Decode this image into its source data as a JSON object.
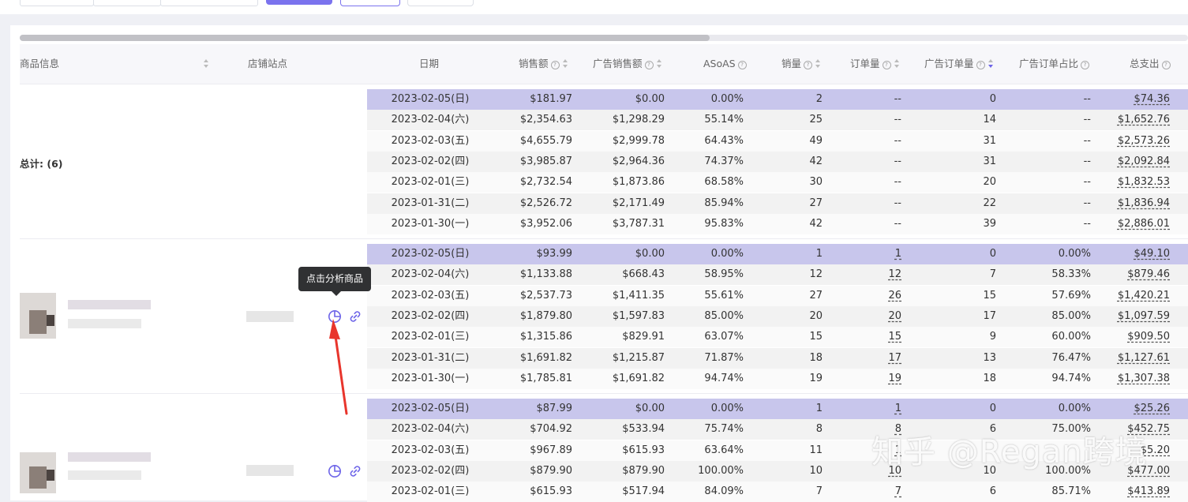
{
  "table": {
    "columns": {
      "product": "商品信息",
      "shop": "店铺站点",
      "date": "日期",
      "sales": "销售额",
      "ad_sales": "广告销售额",
      "asoas": "ASoAS",
      "units": "销量",
      "orders": "订单量",
      "ad_orders": "广告订单量",
      "ad_order_ratio": "广告订单占比",
      "total_spend": "总支出"
    },
    "total_label": "总计: (6)",
    "groups": [
      {
        "rows": [
          {
            "date": "2023-02-05(日)",
            "sales": "$181.97",
            "ad_sales": "$0.00",
            "asoas": "0.00%",
            "units": "2",
            "orders": "--",
            "ad_orders": "0",
            "ratio": "--",
            "spend": "$74.36"
          },
          {
            "date": "2023-02-04(六)",
            "sales": "$2,354.63",
            "ad_sales": "$1,298.29",
            "asoas": "55.14%",
            "units": "25",
            "orders": "--",
            "ad_orders": "14",
            "ratio": "--",
            "spend": "$1,652.76"
          },
          {
            "date": "2023-02-03(五)",
            "sales": "$4,655.79",
            "ad_sales": "$2,999.78",
            "asoas": "64.43%",
            "units": "49",
            "orders": "--",
            "ad_orders": "31",
            "ratio": "--",
            "spend": "$2,573.26"
          },
          {
            "date": "2023-02-02(四)",
            "sales": "$3,985.87",
            "ad_sales": "$2,964.36",
            "asoas": "74.37%",
            "units": "42",
            "orders": "--",
            "ad_orders": "31",
            "ratio": "--",
            "spend": "$2,092.84"
          },
          {
            "date": "2023-02-01(三)",
            "sales": "$2,732.54",
            "ad_sales": "$1,873.86",
            "asoas": "68.58%",
            "units": "30",
            "orders": "--",
            "ad_orders": "20",
            "ratio": "--",
            "spend": "$1,832.53"
          },
          {
            "date": "2023-01-31(二)",
            "sales": "$2,526.72",
            "ad_sales": "$2,171.49",
            "asoas": "85.94%",
            "units": "27",
            "orders": "--",
            "ad_orders": "22",
            "ratio": "--",
            "spend": "$1,836.94"
          },
          {
            "date": "2023-01-30(一)",
            "sales": "$3,952.06",
            "ad_sales": "$3,787.31",
            "asoas": "95.83%",
            "units": "42",
            "orders": "--",
            "ad_orders": "39",
            "ratio": "--",
            "spend": "$2,886.01"
          }
        ]
      },
      {
        "rows": [
          {
            "date": "2023-02-05(日)",
            "sales": "$93.99",
            "ad_sales": "$0.00",
            "asoas": "0.00%",
            "units": "1",
            "orders": "1",
            "ad_orders": "0",
            "ratio": "0.00%",
            "spend": "$49.10"
          },
          {
            "date": "2023-02-04(六)",
            "sales": "$1,133.88",
            "ad_sales": "$668.43",
            "asoas": "58.95%",
            "units": "12",
            "orders": "12",
            "ad_orders": "7",
            "ratio": "58.33%",
            "spend": "$879.46"
          },
          {
            "date": "2023-02-03(五)",
            "sales": "$2,537.73",
            "ad_sales": "$1,411.35",
            "asoas": "55.61%",
            "units": "27",
            "orders": "26",
            "ad_orders": "15",
            "ratio": "57.69%",
            "spend": "$1,420.21"
          },
          {
            "date": "2023-02-02(四)",
            "sales": "$1,879.80",
            "ad_sales": "$1,597.83",
            "asoas": "85.00%",
            "units": "20",
            "orders": "20",
            "ad_orders": "17",
            "ratio": "85.00%",
            "spend": "$1,097.59"
          },
          {
            "date": "2023-02-01(三)",
            "sales": "$1,315.86",
            "ad_sales": "$829.91",
            "asoas": "63.07%",
            "units": "15",
            "orders": "15",
            "ad_orders": "9",
            "ratio": "60.00%",
            "spend": "$909.50"
          },
          {
            "date": "2023-01-31(二)",
            "sales": "$1,691.82",
            "ad_sales": "$1,215.87",
            "asoas": "71.87%",
            "units": "18",
            "orders": "17",
            "ad_orders": "13",
            "ratio": "76.47%",
            "spend": "$1,127.61"
          },
          {
            "date": "2023-01-30(一)",
            "sales": "$1,785.81",
            "ad_sales": "$1,691.82",
            "asoas": "94.74%",
            "units": "19",
            "orders": "19",
            "ad_orders": "18",
            "ratio": "94.74%",
            "spend": "$1,307.38"
          }
        ]
      },
      {
        "rows": [
          {
            "date": "2023-02-05(日)",
            "sales": "$87.99",
            "ad_sales": "$0.00",
            "asoas": "0.00%",
            "units": "1",
            "orders": "1",
            "ad_orders": "0",
            "ratio": "0.00%",
            "spend": "$25.26"
          },
          {
            "date": "2023-02-04(六)",
            "sales": "$704.92",
            "ad_sales": "$533.94",
            "asoas": "75.74%",
            "units": "8",
            "orders": "8",
            "ad_orders": "6",
            "ratio": "75.00%",
            "spend": "$452.75"
          },
          {
            "date": "2023-02-03(五)",
            "sales": "$967.89",
            "ad_sales": "$615.93",
            "asoas": "63.64%",
            "units": "11",
            "orders": "1",
            "ad_orders": "",
            "ratio": "",
            "spend": "$5.20"
          },
          {
            "date": "2023-02-02(四)",
            "sales": "$879.90",
            "ad_sales": "$879.90",
            "asoas": "100.00%",
            "units": "10",
            "orders": "10",
            "ad_orders": "10",
            "ratio": "100.00%",
            "spend": "$477.00"
          },
          {
            "date": "2023-02-01(三)",
            "sales": "$615.93",
            "ad_sales": "$517.94",
            "asoas": "84.09%",
            "units": "7",
            "orders": "7",
            "ad_orders": "6",
            "ratio": "85.71%",
            "spend": "$413.89"
          }
        ]
      }
    ]
  },
  "tooltip": {
    "text": "点击分析商品"
  },
  "icons": {
    "analyze": "pie-chart-icon",
    "link": "link-icon"
  },
  "watermark": "知乎 @Regan跨境",
  "colors": {
    "accent": "#6d64e8",
    "highlight_row": "#c8c6ec",
    "annotation_arrow": "#e8352c"
  }
}
